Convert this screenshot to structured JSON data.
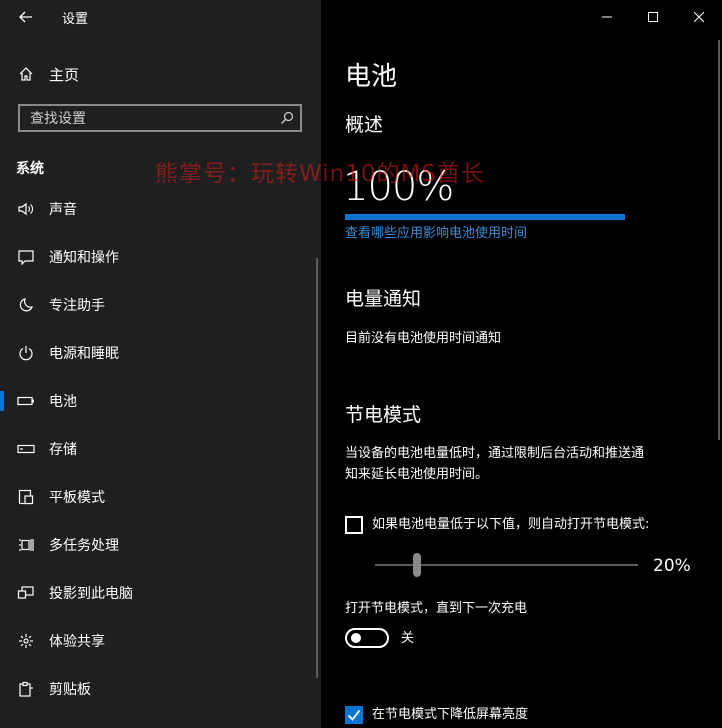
{
  "window": {
    "title": "设置",
    "icons": {
      "back": "back-arrow-icon",
      "minimize": "minimize-icon",
      "maximize": "maximize-icon",
      "close": "close-icon"
    }
  },
  "sidebar": {
    "home_label": "主页",
    "search_placeholder": "查找设置",
    "section": "系统",
    "items": [
      {
        "label": "声音",
        "icon": "speaker-icon",
        "active": false
      },
      {
        "label": "通知和操作",
        "icon": "notification-icon",
        "active": false
      },
      {
        "label": "专注助手",
        "icon": "moon-icon",
        "active": false
      },
      {
        "label": "电源和睡眠",
        "icon": "power-icon",
        "active": false
      },
      {
        "label": "电池",
        "icon": "battery-icon",
        "active": true
      },
      {
        "label": "存储",
        "icon": "storage-icon",
        "active": false
      },
      {
        "label": "平板模式",
        "icon": "tablet-mode-icon",
        "active": false
      },
      {
        "label": "多任务处理",
        "icon": "multitasking-icon",
        "active": false
      },
      {
        "label": "投影到此电脑",
        "icon": "projection-icon",
        "active": false
      },
      {
        "label": "体验共享",
        "icon": "shared-experiences-icon",
        "active": false
      },
      {
        "label": "剪贴板",
        "icon": "clipboard-icon",
        "active": false
      }
    ]
  },
  "main": {
    "title": "电池",
    "overview": {
      "heading": "概述",
      "percent_text": "100%",
      "percent_value": 100,
      "link": "查看哪些应用影响电池使用时间"
    },
    "notifications": {
      "heading": "电量通知",
      "text": "目前没有电池使用时间通知"
    },
    "saver": {
      "heading": "节电模式",
      "description_line1": "当设备的电池电量低时，通过限制后台活动和推送通",
      "description_line2": "知来延长电池使用时间。",
      "auto_checkbox_label": "如果电池电量低于以下值，则自动打开节电模式:",
      "auto_checked": false,
      "threshold_text": "20%",
      "threshold_value": 20,
      "toggle_label": "打开节电模式，直到下一次充电",
      "toggle_state": "关",
      "toggle_on": false,
      "brightness_checkbox_label": "在节电模式下降低屏幕亮度",
      "brightness_checked": true
    }
  },
  "watermark": "熊掌号：玩转Win10的MS酋长",
  "colors": {
    "accent": "#0a74d0",
    "link": "#3a8fd8",
    "sidebar_bg": "#1f1f1f",
    "content_bg": "#000000"
  }
}
